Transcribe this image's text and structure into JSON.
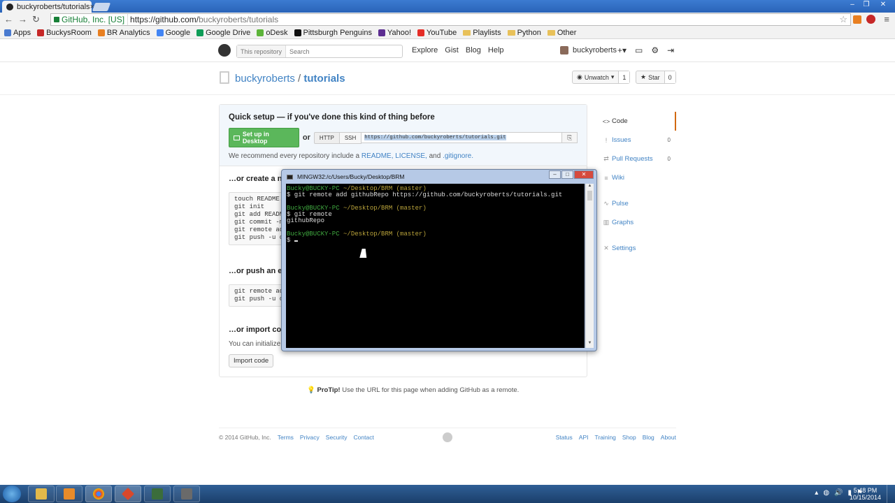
{
  "browser": {
    "tab_title": "buckyroberts/tutorials",
    "tab_close": "×",
    "ev_label": "GitHub, Inc. [US]",
    "url_host": "https://github.com/",
    "url_path": "buckyroberts/tutorials",
    "bookmarks": [
      {
        "label": "Apps",
        "color": "#4a7bd0"
      },
      {
        "label": "BuckysRoom",
        "color": "#c62828"
      },
      {
        "label": "BR Analytics",
        "color": "#e87f21"
      },
      {
        "label": "Google",
        "color": "#4285f4"
      },
      {
        "label": "Google Drive",
        "color": "#0f9d58"
      },
      {
        "label": "oDesk",
        "color": "#5db43a"
      },
      {
        "label": "Pittsburgh Penguins",
        "color": "#111111"
      },
      {
        "label": "Yahoo!",
        "color": "#5c2d91"
      },
      {
        "label": "YouTube",
        "color": "#e52d27"
      },
      {
        "label": "Playlists",
        "color": "#e8c15a"
      },
      {
        "label": "Python",
        "color": "#e8c15a"
      },
      {
        "label": "Other",
        "color": "#e8c15a"
      }
    ]
  },
  "github": {
    "search_scope": "This repository",
    "search_placeholder": "Search",
    "nav": [
      "Explore",
      "Gist",
      "Blog",
      "Help"
    ],
    "username": "buckyroberts",
    "repo_owner": "buckyroberts",
    "repo_sep": "/",
    "repo_name": "tutorials",
    "unwatch_label": "Unwatch",
    "watch_count": "1",
    "star_label": "Star",
    "star_count": "0"
  },
  "quick_setup": {
    "title": "Quick setup — if you've done this kind of thing before",
    "desktop_button": "Set up in Desktop",
    "or": "or",
    "http": "HTTP",
    "ssh": "SSH",
    "clone_url": "https://github.com/buckyroberts/tutorials.git",
    "note_prefix": "We recommend every repository include a",
    "readme": "README,",
    "license": "LICENSE,",
    "and": "and",
    "gitignore": ".gitignore."
  },
  "sections": {
    "create_title": "…or create a n",
    "create_lines": [
      "touch README.",
      "git init",
      "git add README",
      "git commit -m",
      "git remote ad",
      "git push -u o"
    ],
    "push_title": "…or push an e",
    "push_lines": [
      "git remote ad",
      "git push -u o"
    ],
    "import_title": "…or import co",
    "import_text": "You can initialize t",
    "import_button": "Import code"
  },
  "sidebar": [
    {
      "icon": "<>",
      "label": "Code",
      "count": ""
    },
    {
      "icon": "!",
      "label": "Issues",
      "count": "0"
    },
    {
      "icon": "⇄",
      "label": "Pull Requests",
      "count": "0"
    },
    {
      "icon": "≡",
      "label": "Wiki",
      "count": ""
    },
    {
      "icon": "∿",
      "label": "Pulse",
      "count": ""
    },
    {
      "icon": "▥",
      "label": "Graphs",
      "count": ""
    },
    {
      "icon": "✕",
      "label": "Settings",
      "count": ""
    }
  ],
  "protip": {
    "bold": "ProTip!",
    "text": "Use the URL for this page when adding GitHub as a remote."
  },
  "footer": {
    "copyright": "© 2014 GitHub, Inc.",
    "left_links": [
      "Terms",
      "Privacy",
      "Security",
      "Contact"
    ],
    "right_links": [
      "Status",
      "API",
      "Training",
      "Shop",
      "Blog",
      "About"
    ]
  },
  "terminal": {
    "title": "MINGW32:/c/Users/Bucky/Desktop/BRM",
    "prompt_user": "Bucky@BUCKY-PC",
    "prompt_path": "~/Desktop/BRM (master)",
    "cmd1": "$ git remote add githubRepo https://github.com/buckyroberts/tutorials.git",
    "cmd2": "$ git remote",
    "out2": "githubRepo",
    "cmd3": "$ "
  },
  "taskbar": {
    "time": "5:48 PM",
    "date": "10/15/2014"
  }
}
